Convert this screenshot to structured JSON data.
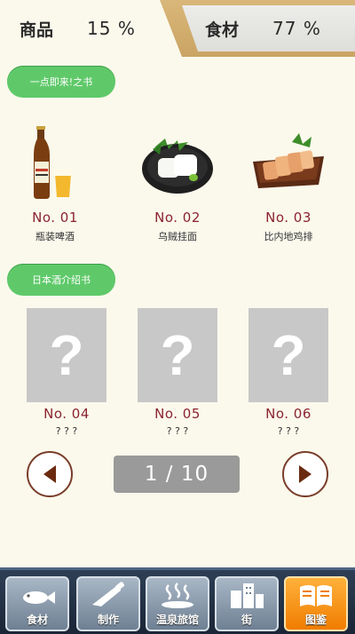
{
  "tabs": {
    "goods": {
      "label": "商品",
      "percent": "15 %"
    },
    "food": {
      "label": "食材",
      "percent": "77 %"
    }
  },
  "sections": [
    {
      "title": "一点即来!之书"
    },
    {
      "title": "日本酒介绍书"
    }
  ],
  "items": [
    {
      "no": "No. 01",
      "name": "瓶装啤酒",
      "icon": "beer-bottle-icon"
    },
    {
      "no": "No. 02",
      "name": "乌贼挂面",
      "icon": "squid-noodles-icon"
    },
    {
      "no": "No. 03",
      "name": "比内地鸡排",
      "icon": "chicken-cutlet-icon"
    },
    {
      "no": "No. 04",
      "name": "? ? ?",
      "icon": "unknown-icon",
      "unknown_mark": "?"
    },
    {
      "no": "No. 05",
      "name": "? ? ?",
      "icon": "unknown-icon",
      "unknown_mark": "?"
    },
    {
      "no": "No. 06",
      "name": "? ? ?",
      "icon": "unknown-icon",
      "unknown_mark": "?"
    }
  ],
  "pager": {
    "indicator": "1 / 10"
  },
  "nav": [
    {
      "label": "食材",
      "icon": "fish-ingredients-icon",
      "active": false
    },
    {
      "label": "制作",
      "icon": "knife-icon",
      "active": false
    },
    {
      "label": "温泉旅馆",
      "icon": "hot-spring-inn-icon",
      "active": false
    },
    {
      "label": "街",
      "icon": "town-buildings-icon",
      "active": false
    },
    {
      "label": "图鉴",
      "icon": "book-encyclopedia-icon",
      "active": true
    }
  ],
  "colors": {
    "background": "#fbf9ec",
    "accent_green": "#5fc96a",
    "number_red": "#8b2330",
    "active_nav": "#f07d00"
  }
}
